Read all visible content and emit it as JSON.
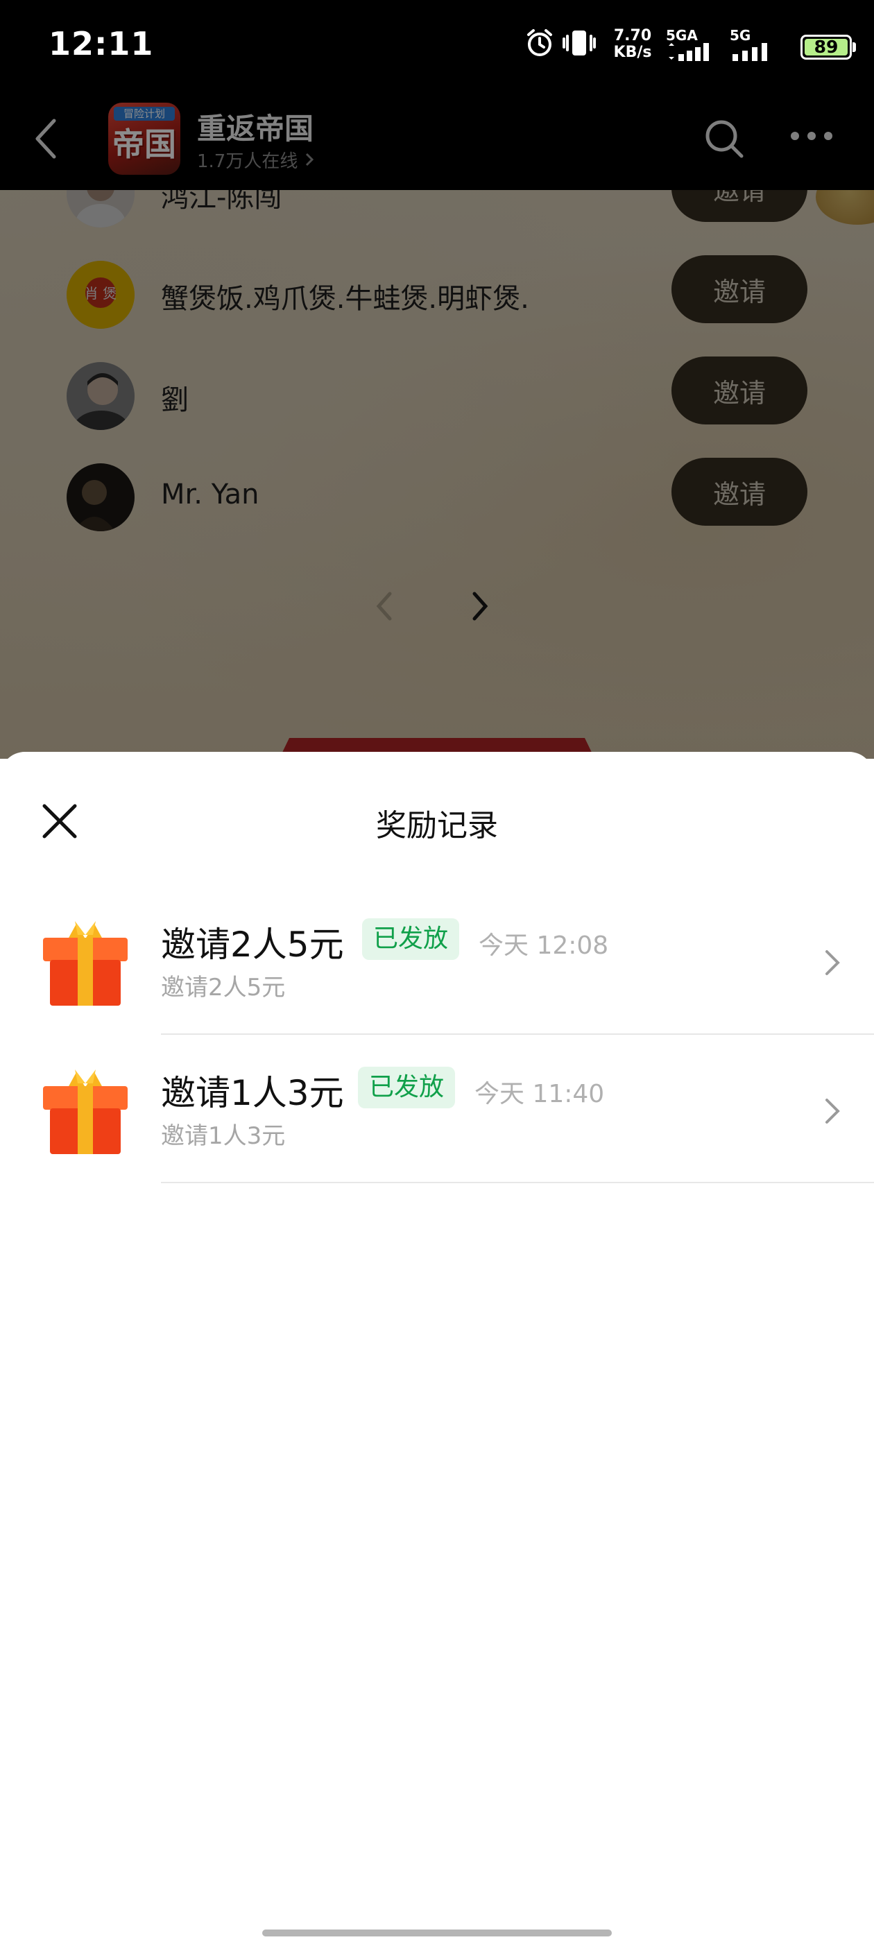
{
  "status_bar": {
    "time": "12:11",
    "speed_value": "7.70",
    "speed_unit": "KB/s",
    "network1": "5GA",
    "network2": "5G",
    "battery": "89",
    "icons": [
      "alarm-icon",
      "vibrate-icon",
      "signal-icon",
      "battery-icon"
    ]
  },
  "header": {
    "title": "重返帝国",
    "subtitle": "1.7万人在线",
    "logo_text": "帝国",
    "logo_banner": "冒险计划",
    "icons": [
      "back-icon",
      "search-icon",
      "more-icon"
    ]
  },
  "background": {
    "friends": [
      {
        "name": "鸿江-陈闯",
        "invite_label": "邀请"
      },
      {
        "name": "蟹煲饭.鸡爪煲.牛蛙煲.明虾煲.",
        "invite_label": "邀请"
      },
      {
        "name": "劉",
        "invite_label": "邀请"
      },
      {
        "name": "Mr. Yan",
        "invite_label": "邀请"
      }
    ],
    "avatar_food_text": "肖 煲"
  },
  "sheet": {
    "title": "奖励记录",
    "records": [
      {
        "title": "邀请2人5元",
        "status": "已发放",
        "time": "今天 12:08",
        "subtitle": "邀请2人5元"
      },
      {
        "title": "邀请1人3元",
        "status": "已发放",
        "time": "今天 11:40",
        "subtitle": "邀请1人3元"
      }
    ]
  },
  "colors": {
    "status_green": "#10a04a",
    "status_green_bg": "#e4f6ea",
    "gift_red": "#f04a1c",
    "gift_ribbon": "#f7b321"
  }
}
